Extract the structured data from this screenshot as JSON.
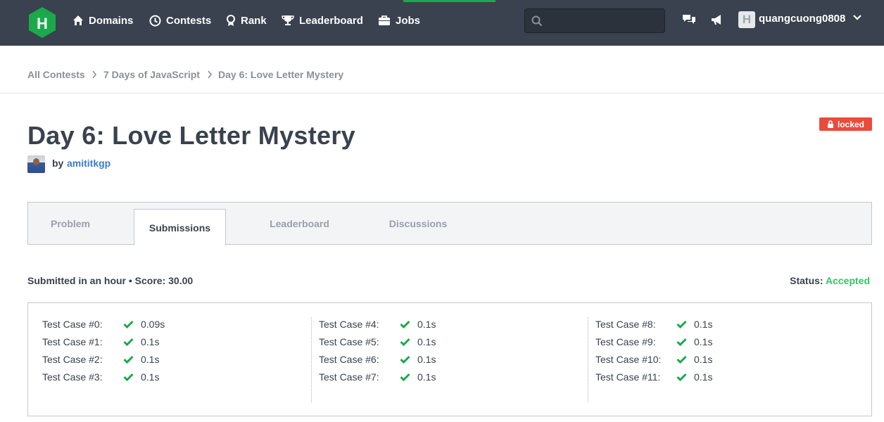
{
  "nav": {
    "items": [
      "Domains",
      "Contests",
      "Rank",
      "Leaderboard",
      "Jobs"
    ],
    "search_placeholder": "",
    "username": "quangcuong0808",
    "avatar_letter": "H"
  },
  "breadcrumb": [
    "All Contests",
    "7 Days of JavaScript",
    "Day 6: Love Letter Mystery"
  ],
  "challenge": {
    "title": "Day 6: Love Letter Mystery",
    "by_label": "by",
    "author": "amititkgp",
    "badge": "locked"
  },
  "tabs": [
    {
      "label": "Problem",
      "active": false
    },
    {
      "label": "Submissions",
      "active": true
    },
    {
      "label": "Leaderboard",
      "active": false
    },
    {
      "label": "Discussions",
      "active": false
    }
  ],
  "submission": {
    "info": "Submitted in an hour • Score: 30.00",
    "status_label": "Status:",
    "status_value": "Accepted"
  },
  "test_cases": [
    {
      "label": "Test Case #0:",
      "time": "0.09s"
    },
    {
      "label": "Test Case #1:",
      "time": "0.1s"
    },
    {
      "label": "Test Case #2:",
      "time": "0.1s"
    },
    {
      "label": "Test Case #3:",
      "time": "0.1s"
    },
    {
      "label": "Test Case #4:",
      "time": "0.1s"
    },
    {
      "label": "Test Case #5:",
      "time": "0.1s"
    },
    {
      "label": "Test Case #6:",
      "time": "0.1s"
    },
    {
      "label": "Test Case #7:",
      "time": "0.1s"
    },
    {
      "label": "Test Case #8:",
      "time": "0.1s"
    },
    {
      "label": "Test Case #9:",
      "time": "0.1s"
    },
    {
      "label": "Test Case #10:",
      "time": "0.1s"
    },
    {
      "label": "Test Case #11:",
      "time": "0.1s"
    }
  ],
  "colors": {
    "nav_bg": "#39424e",
    "accent_green": "#1ba94c",
    "accepted": "#2ec866",
    "locked": "#ea4b3c",
    "link": "#3a7bd5"
  }
}
